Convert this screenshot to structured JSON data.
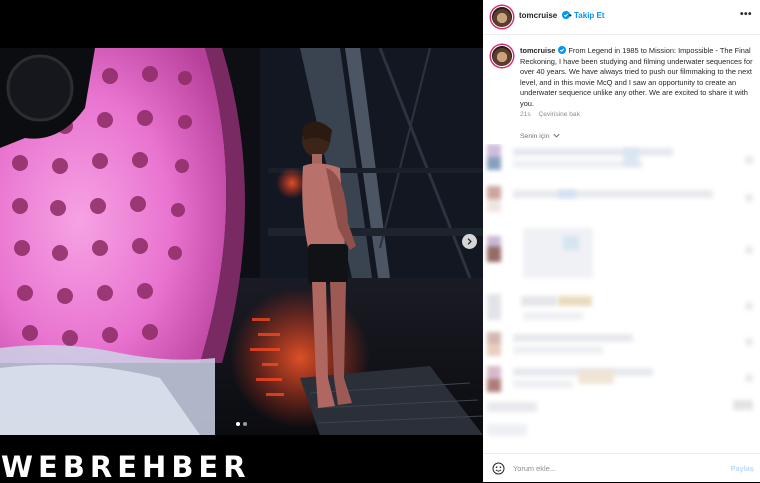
{
  "header": {
    "username": "tomcruise",
    "separator": "•",
    "follow_label": "Takip Et",
    "more_label": "•••"
  },
  "caption": {
    "username": "tomcruise",
    "text": "From Legend in 1985 to Mission: Impossible - The Final Reckoning, I have been studying and filming underwater sequences for over 40 years. We have always tried to push our filmmaking to the next level, and in this movie McQ and I saw an opportunity to create an underwater sequence unlike any other. We are excited to share it with you.",
    "time": "21s",
    "translate_label": "Çevirisine bak"
  },
  "comments": {
    "filter_label": "Senin için"
  },
  "comment_box": {
    "placeholder": "Yorum ekle...",
    "post_label": "Paylaş"
  },
  "media": {
    "watermark": "WEBREHBER",
    "carousel_count": 2,
    "carousel_active": 1
  },
  "colors": {
    "accent": "#0095f6",
    "verified": "#0095f6",
    "watermark_accent": "#e3342f"
  },
  "icons": {
    "verified": "verified-badge-icon",
    "more": "more-options-icon",
    "next": "chevron-right-icon",
    "emoji": "emoji-icon",
    "filter_chevron": "chevron-down-icon"
  }
}
